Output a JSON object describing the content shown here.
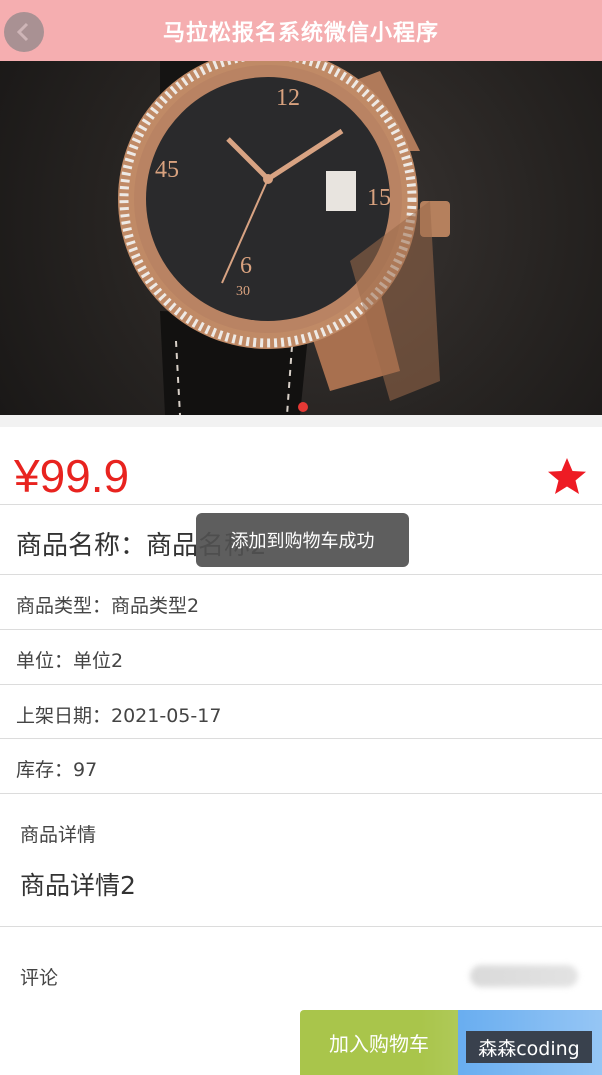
{
  "header": {
    "title": "马拉松报名系统微信小程序"
  },
  "product": {
    "price": "¥99.9",
    "name": "商品名称：商品名称2",
    "type": "商品类型：商品类型2",
    "unit": "单位：单位2",
    "date": "上架日期：2021-05-17",
    "stock": "库存：97"
  },
  "detail": {
    "label": "商品详情",
    "content": "商品详情2"
  },
  "comment": {
    "label": "评论"
  },
  "actions": {
    "add_to_cart": "加入购物车"
  },
  "toast": {
    "message": "添加到购物车成功"
  },
  "watermark": {
    "text": "森森coding"
  },
  "colors": {
    "header": "#f5aeb0",
    "price": "#e8231f",
    "cart_button": "#a9c54b",
    "buy_button": "#5da7ef"
  }
}
